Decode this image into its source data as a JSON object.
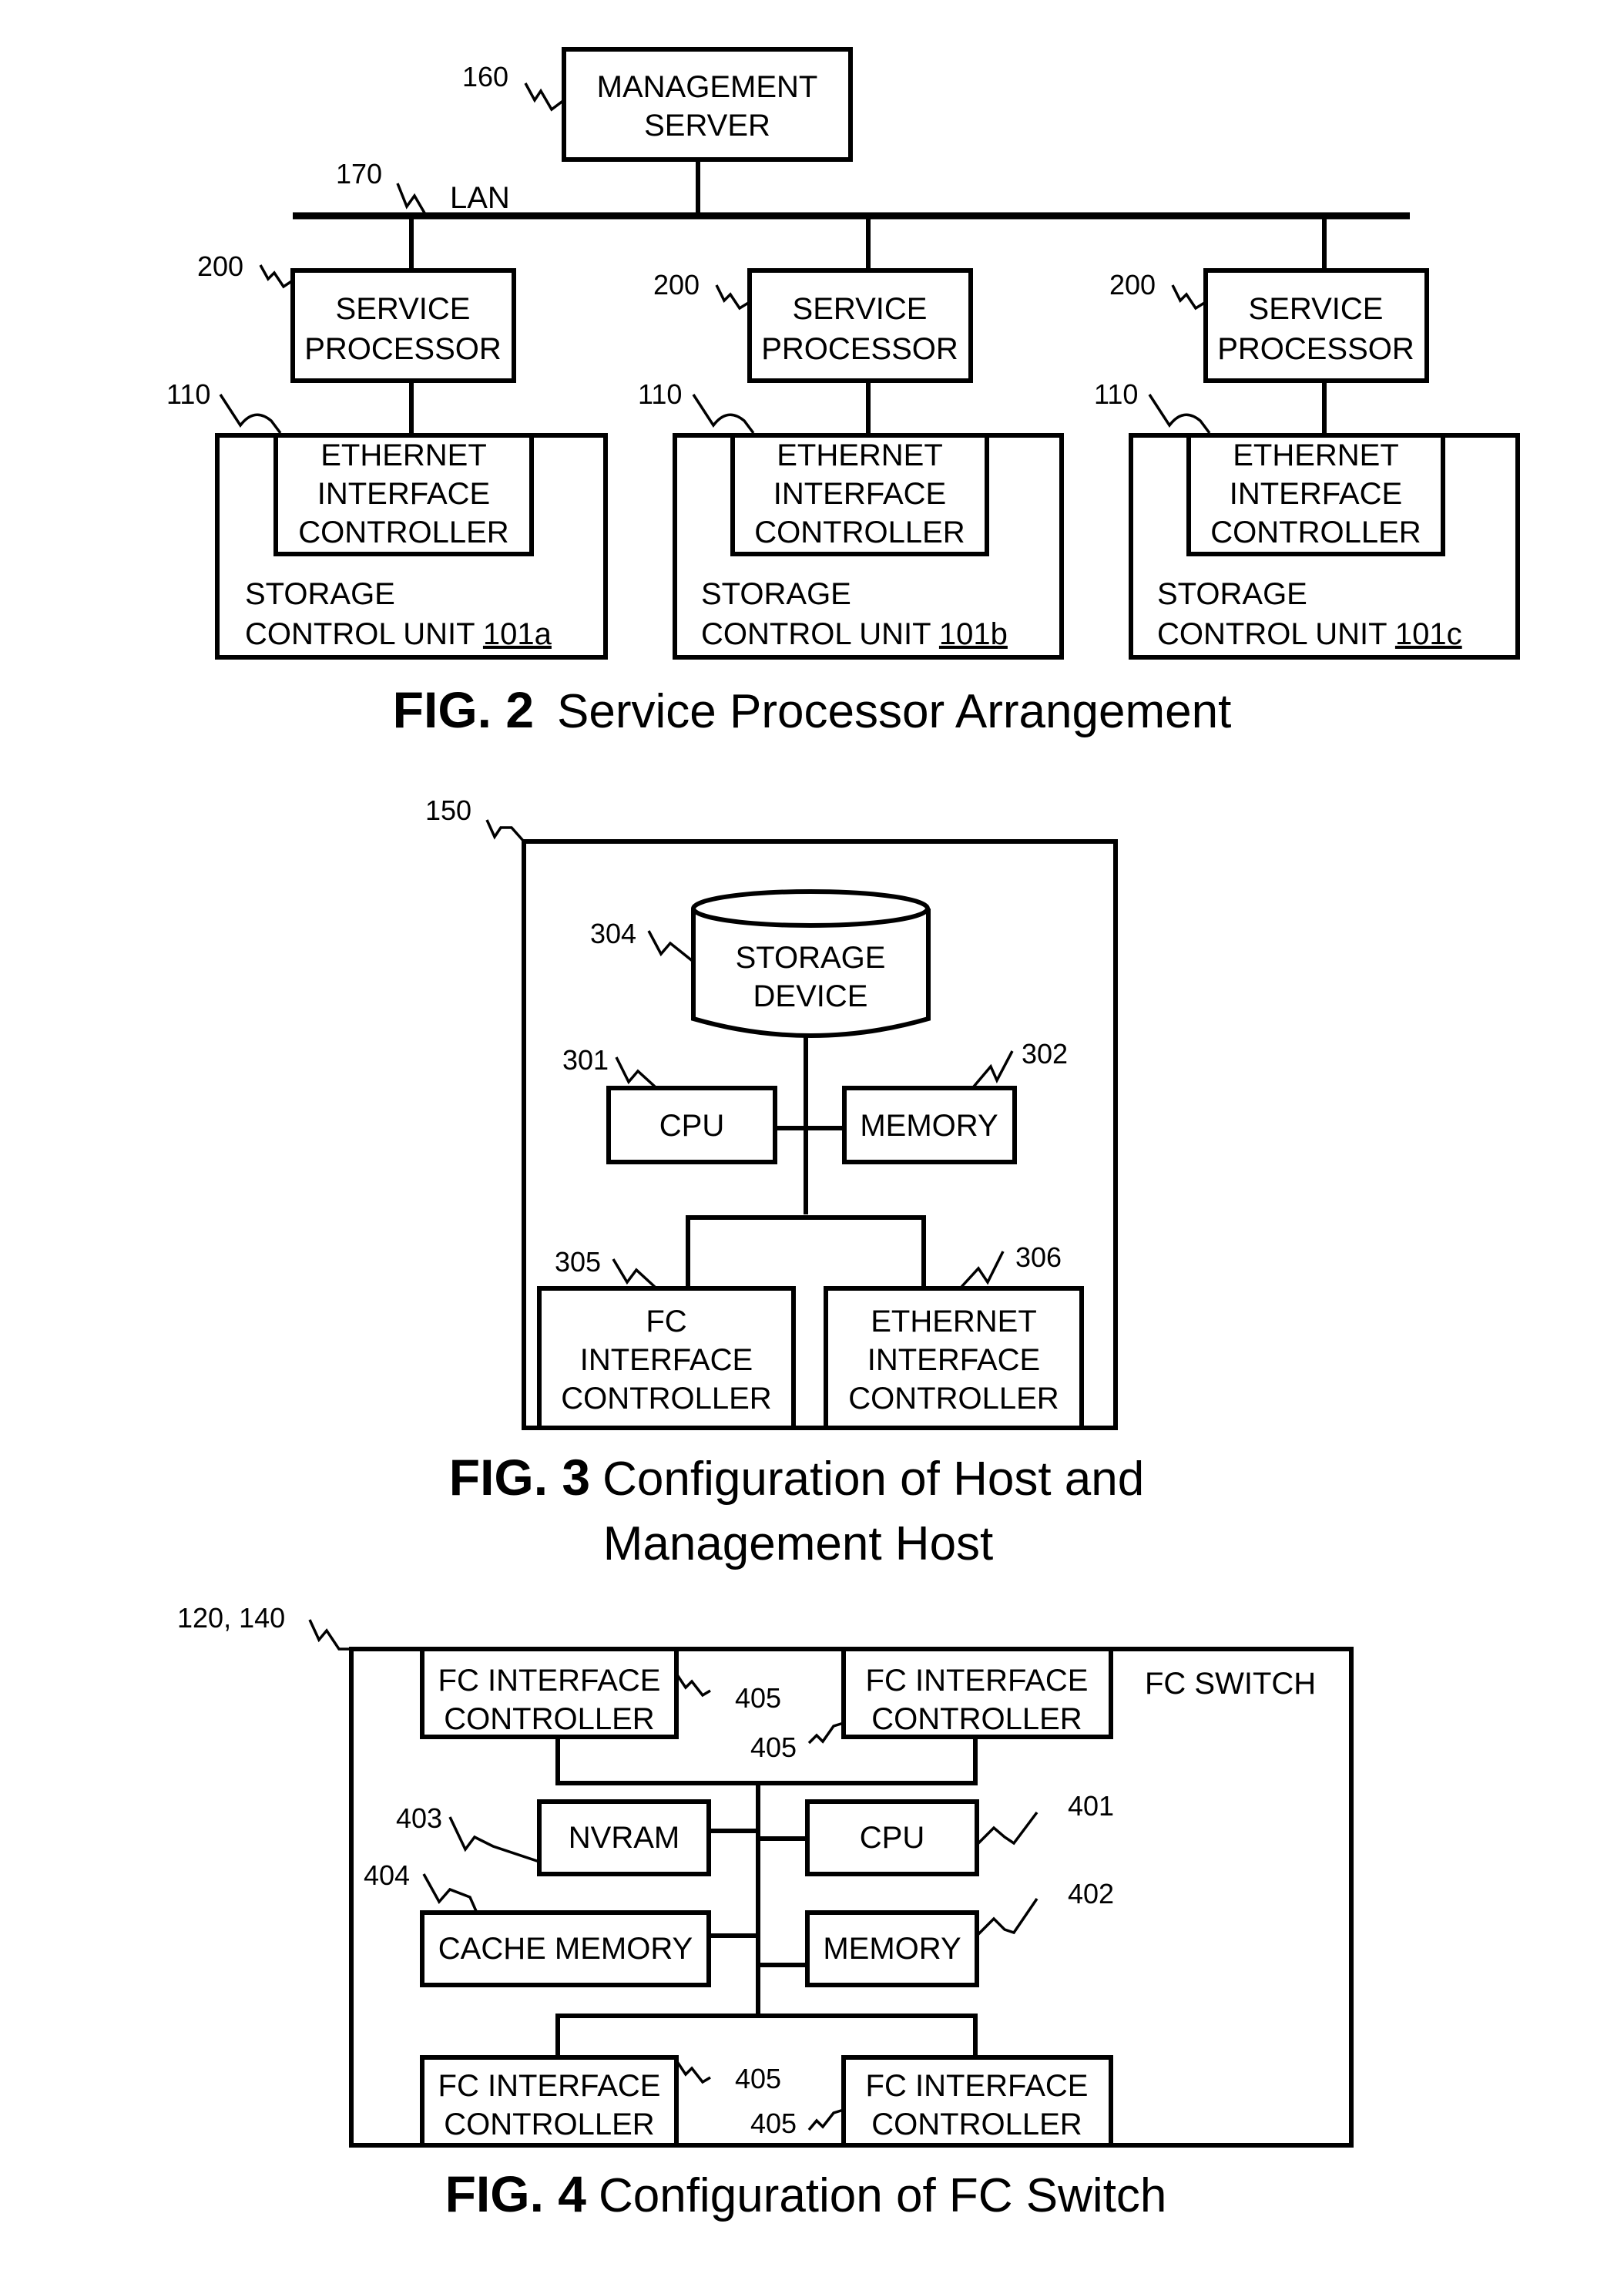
{
  "fig2": {
    "caption_num": "FIG. 2",
    "caption_text": "Service Processor Arrangement",
    "management_server": {
      "ref": "160",
      "line1": "MANAGEMENT",
      "line2": "SERVER"
    },
    "lan": {
      "ref": "170",
      "label": "LAN"
    },
    "units": [
      {
        "sp_ref": "200",
        "sp_line1": "SERVICE",
        "sp_line2": "PROCESSOR",
        "eth_ref": "110",
        "eth_line1": "ETHERNET",
        "eth_line2": "INTERFACE",
        "eth_line3": "CONTROLLER",
        "scu_line1": "STORAGE",
        "scu_line2": "CONTROL UNIT",
        "scu_id": "101a"
      },
      {
        "sp_ref": "200",
        "sp_line1": "SERVICE",
        "sp_line2": "PROCESSOR",
        "eth_ref": "110",
        "eth_line1": "ETHERNET",
        "eth_line2": "INTERFACE",
        "eth_line3": "CONTROLLER",
        "scu_line1": "STORAGE",
        "scu_line2": "CONTROL UNIT",
        "scu_id": "101b"
      },
      {
        "sp_ref": "200",
        "sp_line1": "SERVICE",
        "sp_line2": "PROCESSOR",
        "eth_ref": "110",
        "eth_line1": "ETHERNET",
        "eth_line2": "INTERFACE",
        "eth_line3": "CONTROLLER",
        "scu_line1": "STORAGE",
        "scu_line2": "CONTROL UNIT",
        "scu_id": "101c"
      }
    ]
  },
  "fig3": {
    "caption_num": "FIG. 3",
    "caption_line1": "Configuration of Host and",
    "caption_line2": "Management Host",
    "host_ref": "150",
    "storage_device": {
      "ref": "304",
      "line1": "STORAGE",
      "line2": "DEVICE"
    },
    "cpu": {
      "ref": "301",
      "label": "CPU"
    },
    "memory": {
      "ref": "302",
      "label": "MEMORY"
    },
    "fc_ctrl": {
      "ref": "305",
      "line1": "FC",
      "line2": "INTERFACE",
      "line3": "CONTROLLER"
    },
    "eth_ctrl": {
      "ref": "306",
      "line1": "ETHERNET",
      "line2": "INTERFACE",
      "line3": "CONTROLLER"
    }
  },
  "fig4": {
    "caption_num": "FIG. 4",
    "caption_text": "Configuration of FC Switch",
    "switch_ref": "120, 140",
    "switch_label": "FC SWITCH",
    "fc_ctrl": {
      "ref": "405",
      "line1": "FC INTERFACE",
      "line2": "CONTROLLER"
    },
    "nvram": {
      "ref": "403",
      "label": "NVRAM"
    },
    "cpu": {
      "ref": "401",
      "label": "CPU"
    },
    "cache": {
      "ref": "404",
      "label": "CACHE MEMORY"
    },
    "memory": {
      "ref": "402",
      "label": "MEMORY"
    }
  }
}
